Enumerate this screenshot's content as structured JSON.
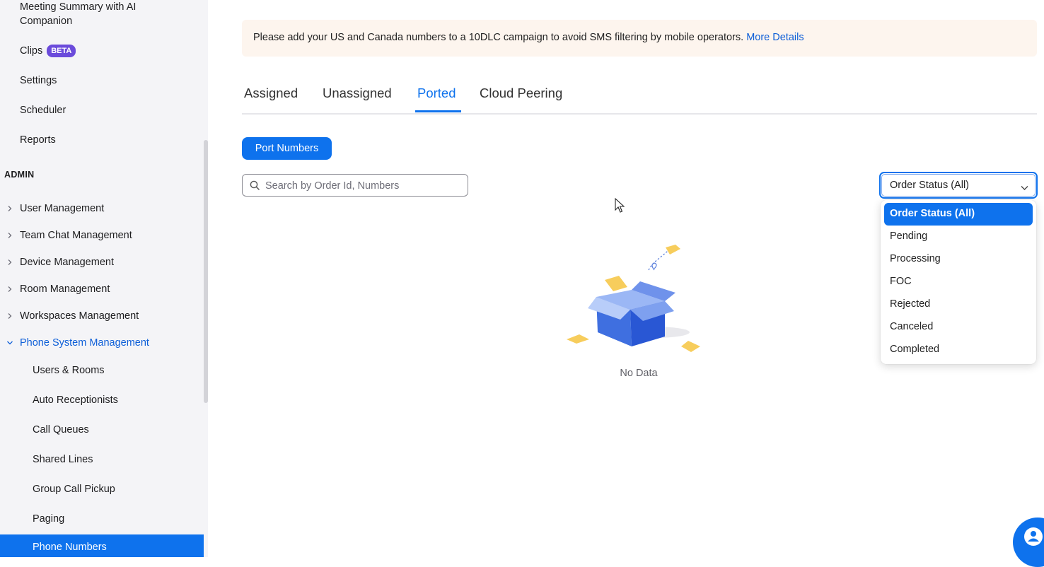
{
  "sidebar": {
    "top_items": [
      {
        "label": "Meeting Summary with AI Companion"
      },
      {
        "label": "Clips",
        "badge": "BETA"
      },
      {
        "label": "Settings"
      },
      {
        "label": "Scheduler"
      },
      {
        "label": "Reports"
      }
    ],
    "admin_heading": "ADMIN",
    "admin_items": [
      {
        "label": "User Management"
      },
      {
        "label": "Team Chat Management"
      },
      {
        "label": "Device Management"
      },
      {
        "label": "Room Management"
      },
      {
        "label": "Workspaces Management"
      },
      {
        "label": "Phone System Management"
      }
    ],
    "phone_sub_items": [
      {
        "label": "Users & Rooms"
      },
      {
        "label": "Auto Receptionists"
      },
      {
        "label": "Call Queues"
      },
      {
        "label": "Shared Lines"
      },
      {
        "label": "Group Call Pickup"
      },
      {
        "label": "Paging"
      },
      {
        "label": "Phone Numbers"
      }
    ]
  },
  "banner": {
    "text": "Please add your US and Canada numbers to a 10DLC campaign to avoid SMS filtering by mobile operators.",
    "link": "More Details"
  },
  "tabs": [
    {
      "label": "Assigned"
    },
    {
      "label": "Unassigned"
    },
    {
      "label": "Ported",
      "active": true
    },
    {
      "label": "Cloud Peering"
    }
  ],
  "toolbar": {
    "port_numbers_label": "Port Numbers",
    "search_placeholder": "Search by Order Id, Numbers"
  },
  "order_status": {
    "selected": "Order Status (All)",
    "options": [
      "Order Status (All)",
      "Pending",
      "Processing",
      "FOC",
      "Rejected",
      "Canceled",
      "Completed"
    ]
  },
  "empty_state": {
    "text": "No Data"
  },
  "colors": {
    "accent": "#0e72ed",
    "beta_badge": "#6b4bdb",
    "banner_bg": "#fdf5ee"
  }
}
